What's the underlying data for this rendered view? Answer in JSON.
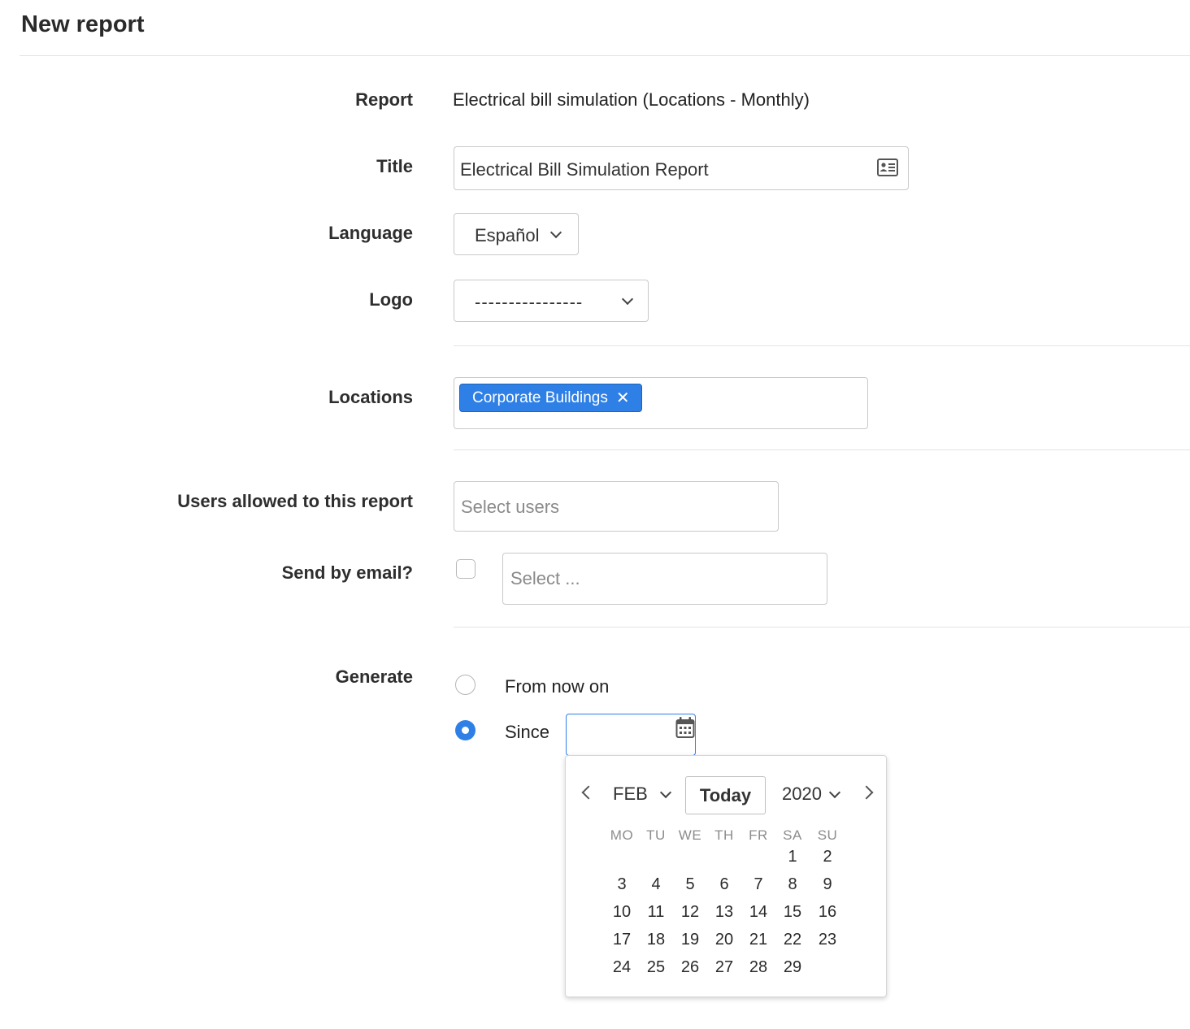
{
  "page": {
    "title": "New report"
  },
  "form": {
    "report": {
      "label": "Report",
      "value": "Electrical bill simulation (Locations - Monthly)"
    },
    "title": {
      "label": "Title",
      "value": "Electrical Bill Simulation Report"
    },
    "language": {
      "label": "Language",
      "selected": "Español"
    },
    "logo": {
      "label": "Logo",
      "selected": "----------------"
    },
    "locations": {
      "label": "Locations",
      "tags": [
        "Corporate Buildings"
      ]
    },
    "users": {
      "label": "Users allowed to this report",
      "placeholder": "Select users"
    },
    "email": {
      "label": "Send by email?",
      "checked": false,
      "placeholder": "Select ..."
    },
    "generate": {
      "label": "Generate",
      "options": [
        {
          "label": "From now on",
          "selected": false
        },
        {
          "label": "Since",
          "selected": true
        }
      ],
      "date_value": ""
    }
  },
  "datepicker": {
    "month": "FEB",
    "year": "2020",
    "today_label": "Today",
    "weekdays": [
      "MO",
      "TU",
      "WE",
      "TH",
      "FR",
      "SA",
      "SU"
    ],
    "weeks": [
      [
        "",
        "",
        "",
        "",
        "",
        "1",
        "2"
      ],
      [
        "3",
        "4",
        "5",
        "6",
        "7",
        "8",
        "9"
      ],
      [
        "10",
        "11",
        "12",
        "13",
        "14",
        "15",
        "16"
      ],
      [
        "17",
        "18",
        "19",
        "20",
        "21",
        "22",
        "23"
      ],
      [
        "24",
        "25",
        "26",
        "27",
        "28",
        "29",
        ""
      ]
    ]
  },
  "colors": {
    "accent": "#2e80e6",
    "border": "#c9c9c9",
    "divider": "#e3e3e3"
  }
}
